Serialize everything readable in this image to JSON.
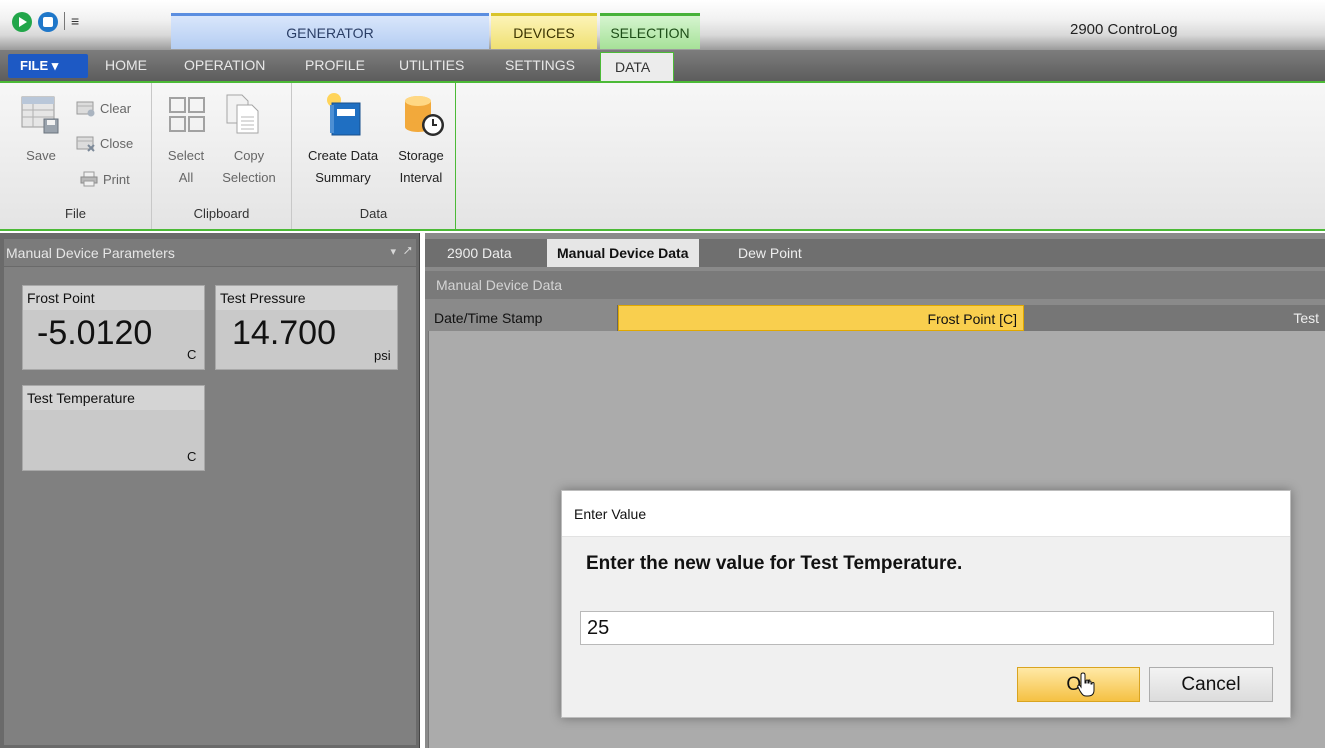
{
  "app": {
    "title": "2900 ControLog"
  },
  "qat": {
    "customize_glyph": "≡"
  },
  "context_tabs": {
    "generator": "GENERATOR",
    "devices": "DEVICES",
    "selection": "SELECTION"
  },
  "tabs": {
    "file": "FILE ▾",
    "home": "HOME",
    "operation": "OPERATION",
    "profile": "PROFILE",
    "utilities": "UTILITIES",
    "settings": "SETTINGS",
    "data": "DATA"
  },
  "ribbon": {
    "file_group": {
      "label": "File",
      "save": "Save",
      "clear": "Clear",
      "close": "Close",
      "print": "Print"
    },
    "clipboard_group": {
      "label": "Clipboard",
      "select_all": [
        "Select",
        "All"
      ],
      "copy_selection": [
        "Copy",
        "Selection"
      ]
    },
    "data_group": {
      "label": "Data",
      "create_summary": [
        "Create Data",
        "Summary"
      ],
      "storage_interval": [
        "Storage",
        "Interval"
      ]
    }
  },
  "left_panel": {
    "title": "Manual Device Parameters",
    "menu_glyph": "▾",
    "pin_glyph": "⭧",
    "cards": {
      "frost_point": {
        "label": "Frost Point",
        "value": "-5.0120",
        "unit": "C"
      },
      "test_pressure": {
        "label": "Test Pressure",
        "value": "14.700",
        "unit": "psi"
      },
      "test_temperature": {
        "label": "Test Temperature",
        "value": "",
        "unit": "C"
      }
    }
  },
  "document": {
    "tabs": [
      "2900 Data",
      "Manual Device Data",
      "Dew Point"
    ],
    "active_tab": "Manual Device Data",
    "subheader": "Manual Device Data",
    "columns": {
      "date": "Date/Time Stamp",
      "frost": "Frost Point [C]",
      "test": "Test"
    }
  },
  "dialog": {
    "title": "Enter Value",
    "prompt": "Enter the new value for Test Temperature.",
    "input_value": "25",
    "ok_label": "Ok",
    "cancel_label": "Cancel"
  },
  "colors": {
    "accent_green": "#4cba37",
    "file_blue": "#1d59c4",
    "highlight_yellow": "#f9cf4e"
  }
}
